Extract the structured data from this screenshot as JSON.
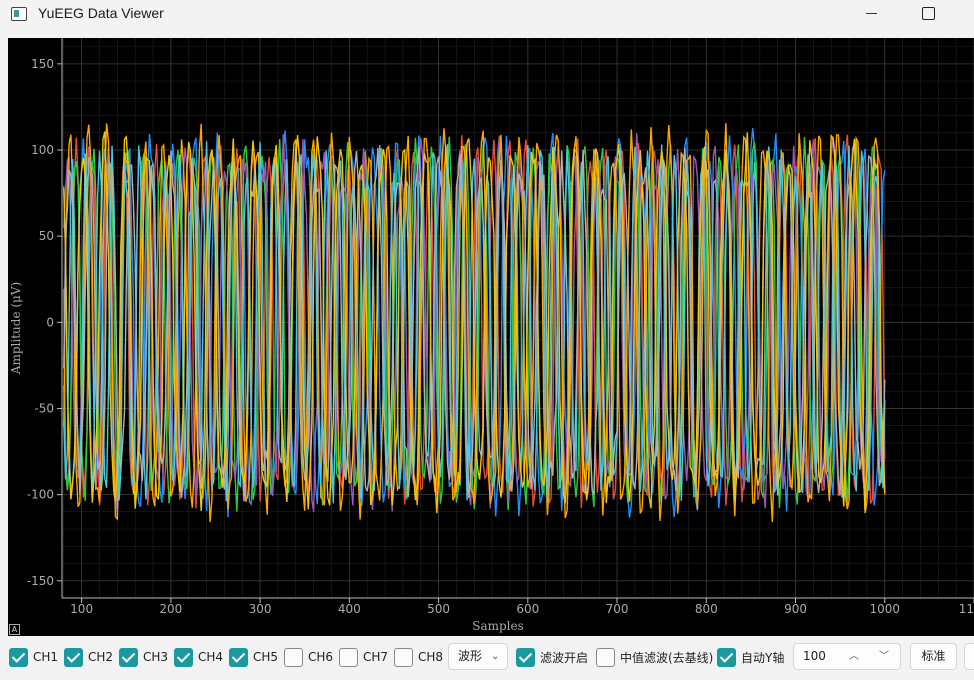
{
  "window": {
    "title": "YuEEG Data Viewer"
  },
  "chart_data": {
    "type": "line",
    "title": "",
    "xlabel": "Samples",
    "ylabel": "Amplitude (μV)",
    "xlim": [
      78,
      1100
    ],
    "ylim": [
      -160,
      165
    ],
    "x_ticks": [
      100,
      200,
      300,
      400,
      500,
      600,
      700,
      800,
      900,
      1000,
      1100
    ],
    "y_ticks": [
      150,
      100,
      50,
      0,
      -50,
      -100,
      -150
    ],
    "grid": true,
    "x_range_of_data": [
      80,
      1000
    ],
    "series": [
      {
        "color": "#e74c3c",
        "amplitude": 100,
        "period": 18,
        "phase": 0.3,
        "noise": 10
      },
      {
        "color": "#1e90ff",
        "amplitude": 100,
        "period": 25,
        "phase": 1.1,
        "noise": 14
      },
      {
        "color": "#2ecc40",
        "amplitude": 100,
        "period": 19,
        "phase": 2.0,
        "noise": 10
      },
      {
        "color": "#9b59b6",
        "amplitude": 95,
        "period": 22,
        "phase": 2.6,
        "noise": 16
      },
      {
        "color": "#ffa500",
        "amplitude": 105,
        "period": 21,
        "phase": 0.8,
        "noise": 12
      },
      {
        "color": "#48c9e0",
        "amplitude": 92,
        "period": 15,
        "phase": 1.7,
        "noise": 14
      },
      {
        "color": "#b0b0b0",
        "amplitude": 90,
        "period": 23,
        "phase": 3.1,
        "noise": 14
      },
      {
        "color": "#f1c40f",
        "amplitude": 100,
        "period": 24,
        "phase": 0.2,
        "noise": 12
      }
    ]
  },
  "toolbar": {
    "channels": [
      {
        "label": "CH1",
        "checked": true
      },
      {
        "label": "CH2",
        "checked": true
      },
      {
        "label": "CH3",
        "checked": true
      },
      {
        "label": "CH4",
        "checked": true
      },
      {
        "label": "CH5",
        "checked": true
      },
      {
        "label": "CH6",
        "checked": false
      },
      {
        "label": "CH7",
        "checked": false
      },
      {
        "label": "CH8",
        "checked": false
      }
    ],
    "view_mode": "波形",
    "filter_enable": {
      "label": "滤波开启",
      "checked": true
    },
    "median_filter": {
      "label": "中值滤波(去基线)",
      "checked": false
    },
    "auto_y": {
      "label": "自动Y轴",
      "checked": true
    },
    "y_range_value": "100",
    "standard_button": "标准"
  },
  "plot": {
    "auto_range_button": "A"
  }
}
